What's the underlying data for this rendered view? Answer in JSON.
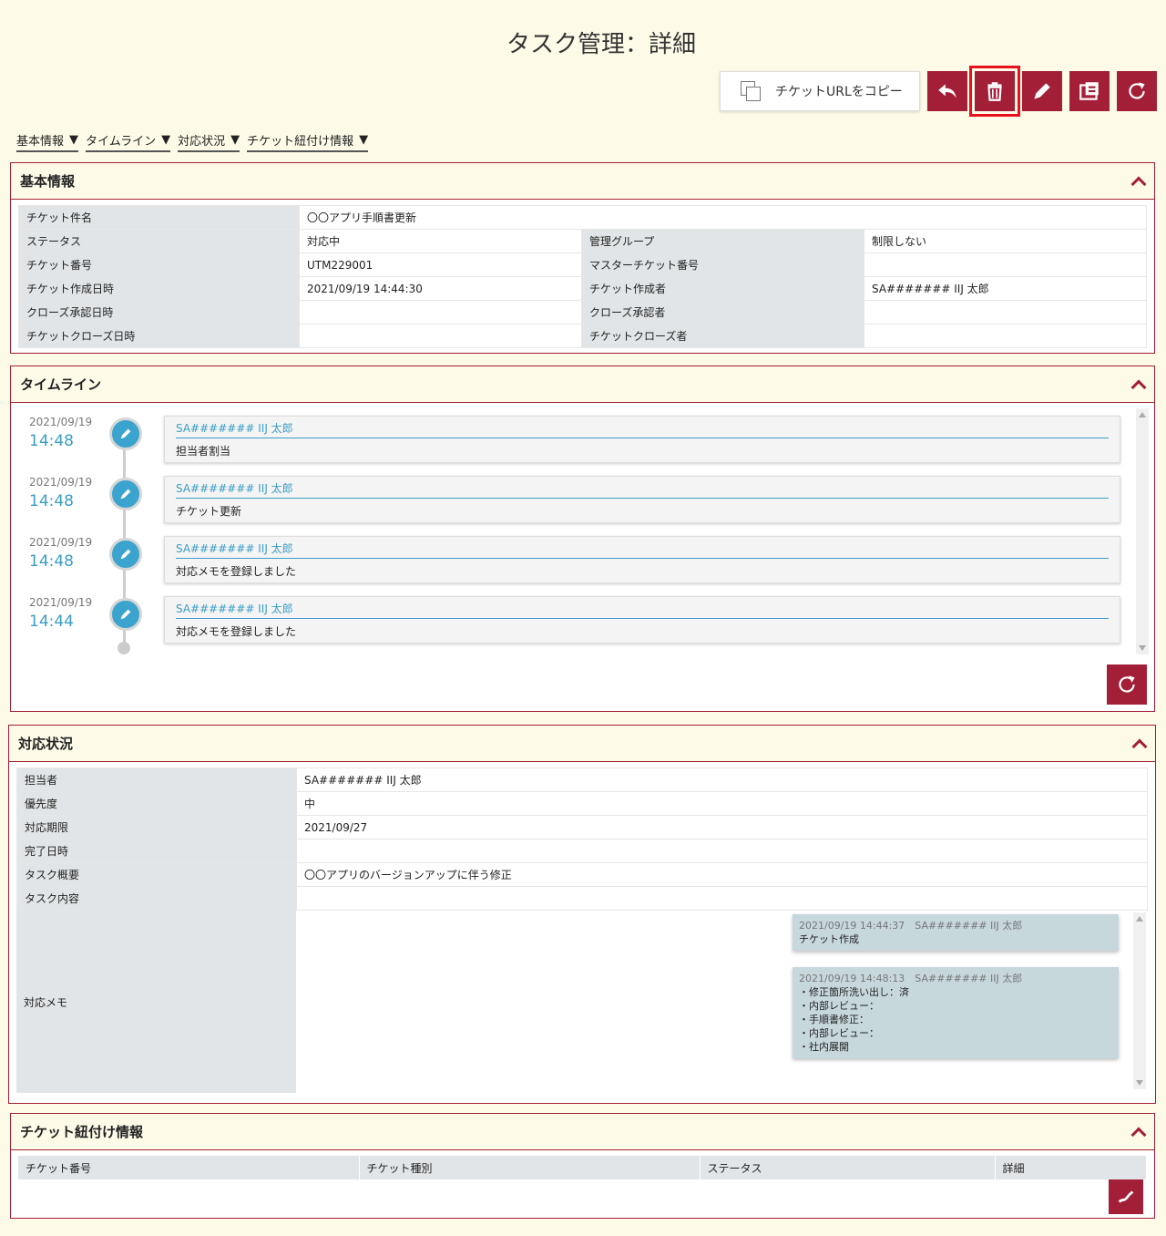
{
  "page": {
    "title": "タスク管理：詳細"
  },
  "toolbar": {
    "copy_label": "チケットURLをコピー",
    "buttons": [
      "back-icon",
      "trash-icon",
      "pencil-icon",
      "ticket-icon",
      "reload-icon"
    ]
  },
  "anchors": [
    {
      "label": "基本情報"
    },
    {
      "label": "タイムライン"
    },
    {
      "label": "対応状況"
    },
    {
      "label": "チケット紐付け情報"
    }
  ],
  "basic": {
    "title": "基本情報",
    "rows": [
      {
        "k1": "チケット件名",
        "v1": "〇〇アプリ手順書更新",
        "k2": "",
        "v2": ""
      },
      {
        "k1": "ステータス",
        "v1": "対応中",
        "k2": "管理グループ",
        "v2": "制限しない"
      },
      {
        "k1": "チケット番号",
        "v1": "UTM229001",
        "k2": "マスターチケット番号",
        "v2": ""
      },
      {
        "k1": "チケット作成日時",
        "v1": "2021/09/19 14:44:30",
        "k2": "チケット作成者",
        "v2": "SA####### IIJ 太郎"
      },
      {
        "k1": "クローズ承認日時",
        "v1": "",
        "k2": "クローズ承認者",
        "v2": ""
      },
      {
        "k1": "チケットクローズ日時",
        "v1": "",
        "k2": "チケットクローズ者",
        "v2": ""
      }
    ]
  },
  "timeline": {
    "title": "タイムライン",
    "items": [
      {
        "date": "2021/09/19",
        "time": "14:48",
        "who": "SA####### IIJ 太郎",
        "msg": "担当者割当"
      },
      {
        "date": "2021/09/19",
        "time": "14:48",
        "who": "SA####### IIJ 太郎",
        "msg": "チケット更新"
      },
      {
        "date": "2021/09/19",
        "time": "14:48",
        "who": "SA####### IIJ 太郎",
        "msg": "対応メモを登録しました"
      },
      {
        "date": "2021/09/19",
        "time": "14:44",
        "who": "SA####### IIJ 太郎",
        "msg": "対応メモを登録しました"
      }
    ]
  },
  "status": {
    "title": "対応状況",
    "rows": [
      {
        "k": "担当者",
        "v": "SA####### IIJ 太郎"
      },
      {
        "k": "優先度",
        "v": "中"
      },
      {
        "k": "対応期限",
        "v": "2021/09/27"
      },
      {
        "k": "完了日時",
        "v": ""
      },
      {
        "k": "タスク概要",
        "v": "〇〇アプリのバージョンアップに伴う修正"
      },
      {
        "k": "タスク内容",
        "v": ""
      }
    ],
    "memo_label": "対応メモ",
    "memos": [
      {
        "meta": "2021/09/19 14:44:37　SA####### IIJ 太郎",
        "lines": [
          "チケット作成"
        ]
      },
      {
        "meta": "2021/09/19 14:48:13　SA####### IIJ 太郎",
        "lines": [
          "・修正箇所洗い出し：済",
          "・内部レビュー：",
          "・手順書修正：",
          "・内部レビュー：",
          "・社内展開"
        ]
      }
    ]
  },
  "link": {
    "title": "チケット紐付け情報",
    "columns": [
      "チケット番号",
      "チケット種別",
      "ステータス",
      "詳細"
    ]
  },
  "colors": {
    "accent": "#a31f38",
    "background": "#fdfbe7",
    "timeline_blue": "#3aa4cf"
  }
}
